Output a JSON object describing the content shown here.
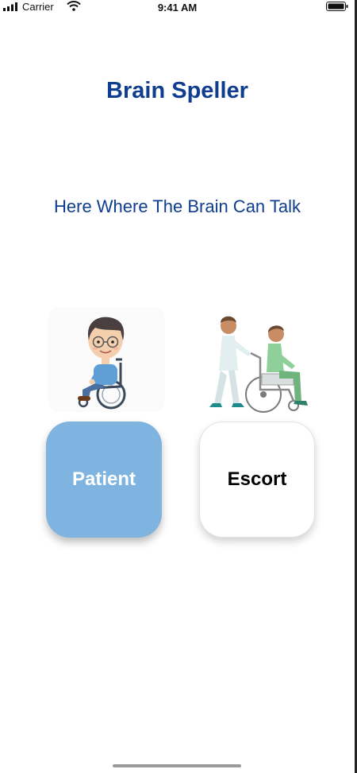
{
  "status_bar": {
    "carrier": "Carrier",
    "time": "9:41 AM",
    "icons": [
      "signal-icon",
      "wifi-icon",
      "battery-icon"
    ]
  },
  "header": {
    "title": "Brain Speller",
    "subtitle": "Here Where The Brain Can Talk"
  },
  "roles": {
    "patient": {
      "label": "Patient",
      "illustration": "patient-wheelchair-illustration",
      "color": "#7fb3e0"
    },
    "escort": {
      "label": "Escort",
      "illustration": "escort-pushing-wheelchair-illustration",
      "color": "#ffffff"
    }
  },
  "colors": {
    "title": "#0f3d8f",
    "patient_button": "#7fb3e0"
  }
}
